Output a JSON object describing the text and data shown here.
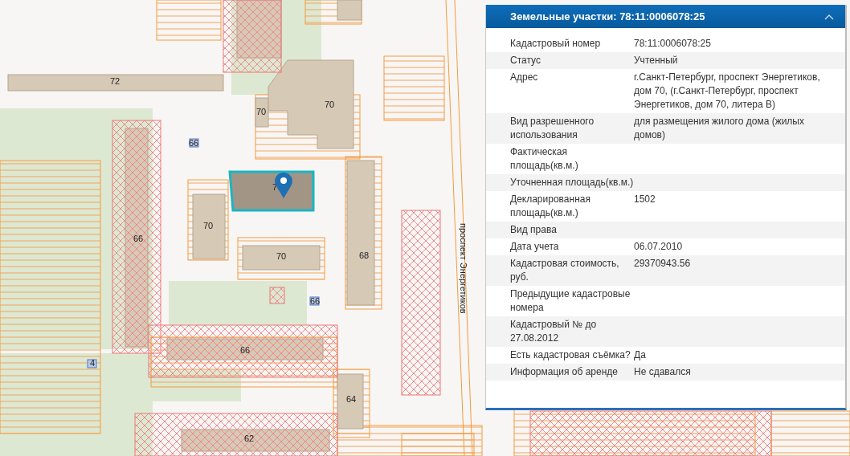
{
  "map": {
    "street_label": "проспект Энергетиков",
    "building_labels": [
      {
        "text": "72"
      },
      {
        "text": "70"
      },
      {
        "text": "70"
      },
      {
        "text": "66"
      },
      {
        "text": "7"
      },
      {
        "text": "70"
      },
      {
        "text": "70"
      },
      {
        "text": "66"
      },
      {
        "text": "68"
      },
      {
        "text": "66"
      },
      {
        "text": "66"
      },
      {
        "text": "4"
      },
      {
        "text": "64"
      },
      {
        "text": "62"
      }
    ]
  },
  "panel": {
    "title": "Земельные участки: 78:11:0006078:25",
    "expanded": true,
    "rows": [
      {
        "label": "Кадастровый номер",
        "value": "78:11:0006078:25"
      },
      {
        "label": "Статус",
        "value": "Учтенный"
      },
      {
        "label": "Адрес",
        "value": "г.Санкт-Петербург, проспект Энергетиков, дом 70, (г.Санкт-Петербург, проспект Энергетиков, дом 70, литера В)"
      },
      {
        "label": "Вид разрешенного использования",
        "value": "для размещения жилого дома (жилых домов)"
      },
      {
        "label": "Фактическая площадь(кв.м.)"
      },
      {
        "label": "Уточненная площадь(кв.м.)"
      },
      {
        "label": "Декларированная площадь(кв.м.)",
        "value": "1502"
      },
      {
        "label": "Вид права"
      },
      {
        "label": "Дата учета",
        "value": "06.07.2010"
      },
      {
        "label": "Кадастровая стоимость, руб.",
        "value": "29370943.56"
      },
      {
        "label": "Предыдущие кадастровые номера"
      },
      {
        "label": "Кадастровый № до 27.08.2012"
      },
      {
        "label": "Есть кадастровая съёмка?",
        "value": "Да"
      },
      {
        "label": "Информация об аренде",
        "value": "Не сдавался"
      }
    ]
  }
}
